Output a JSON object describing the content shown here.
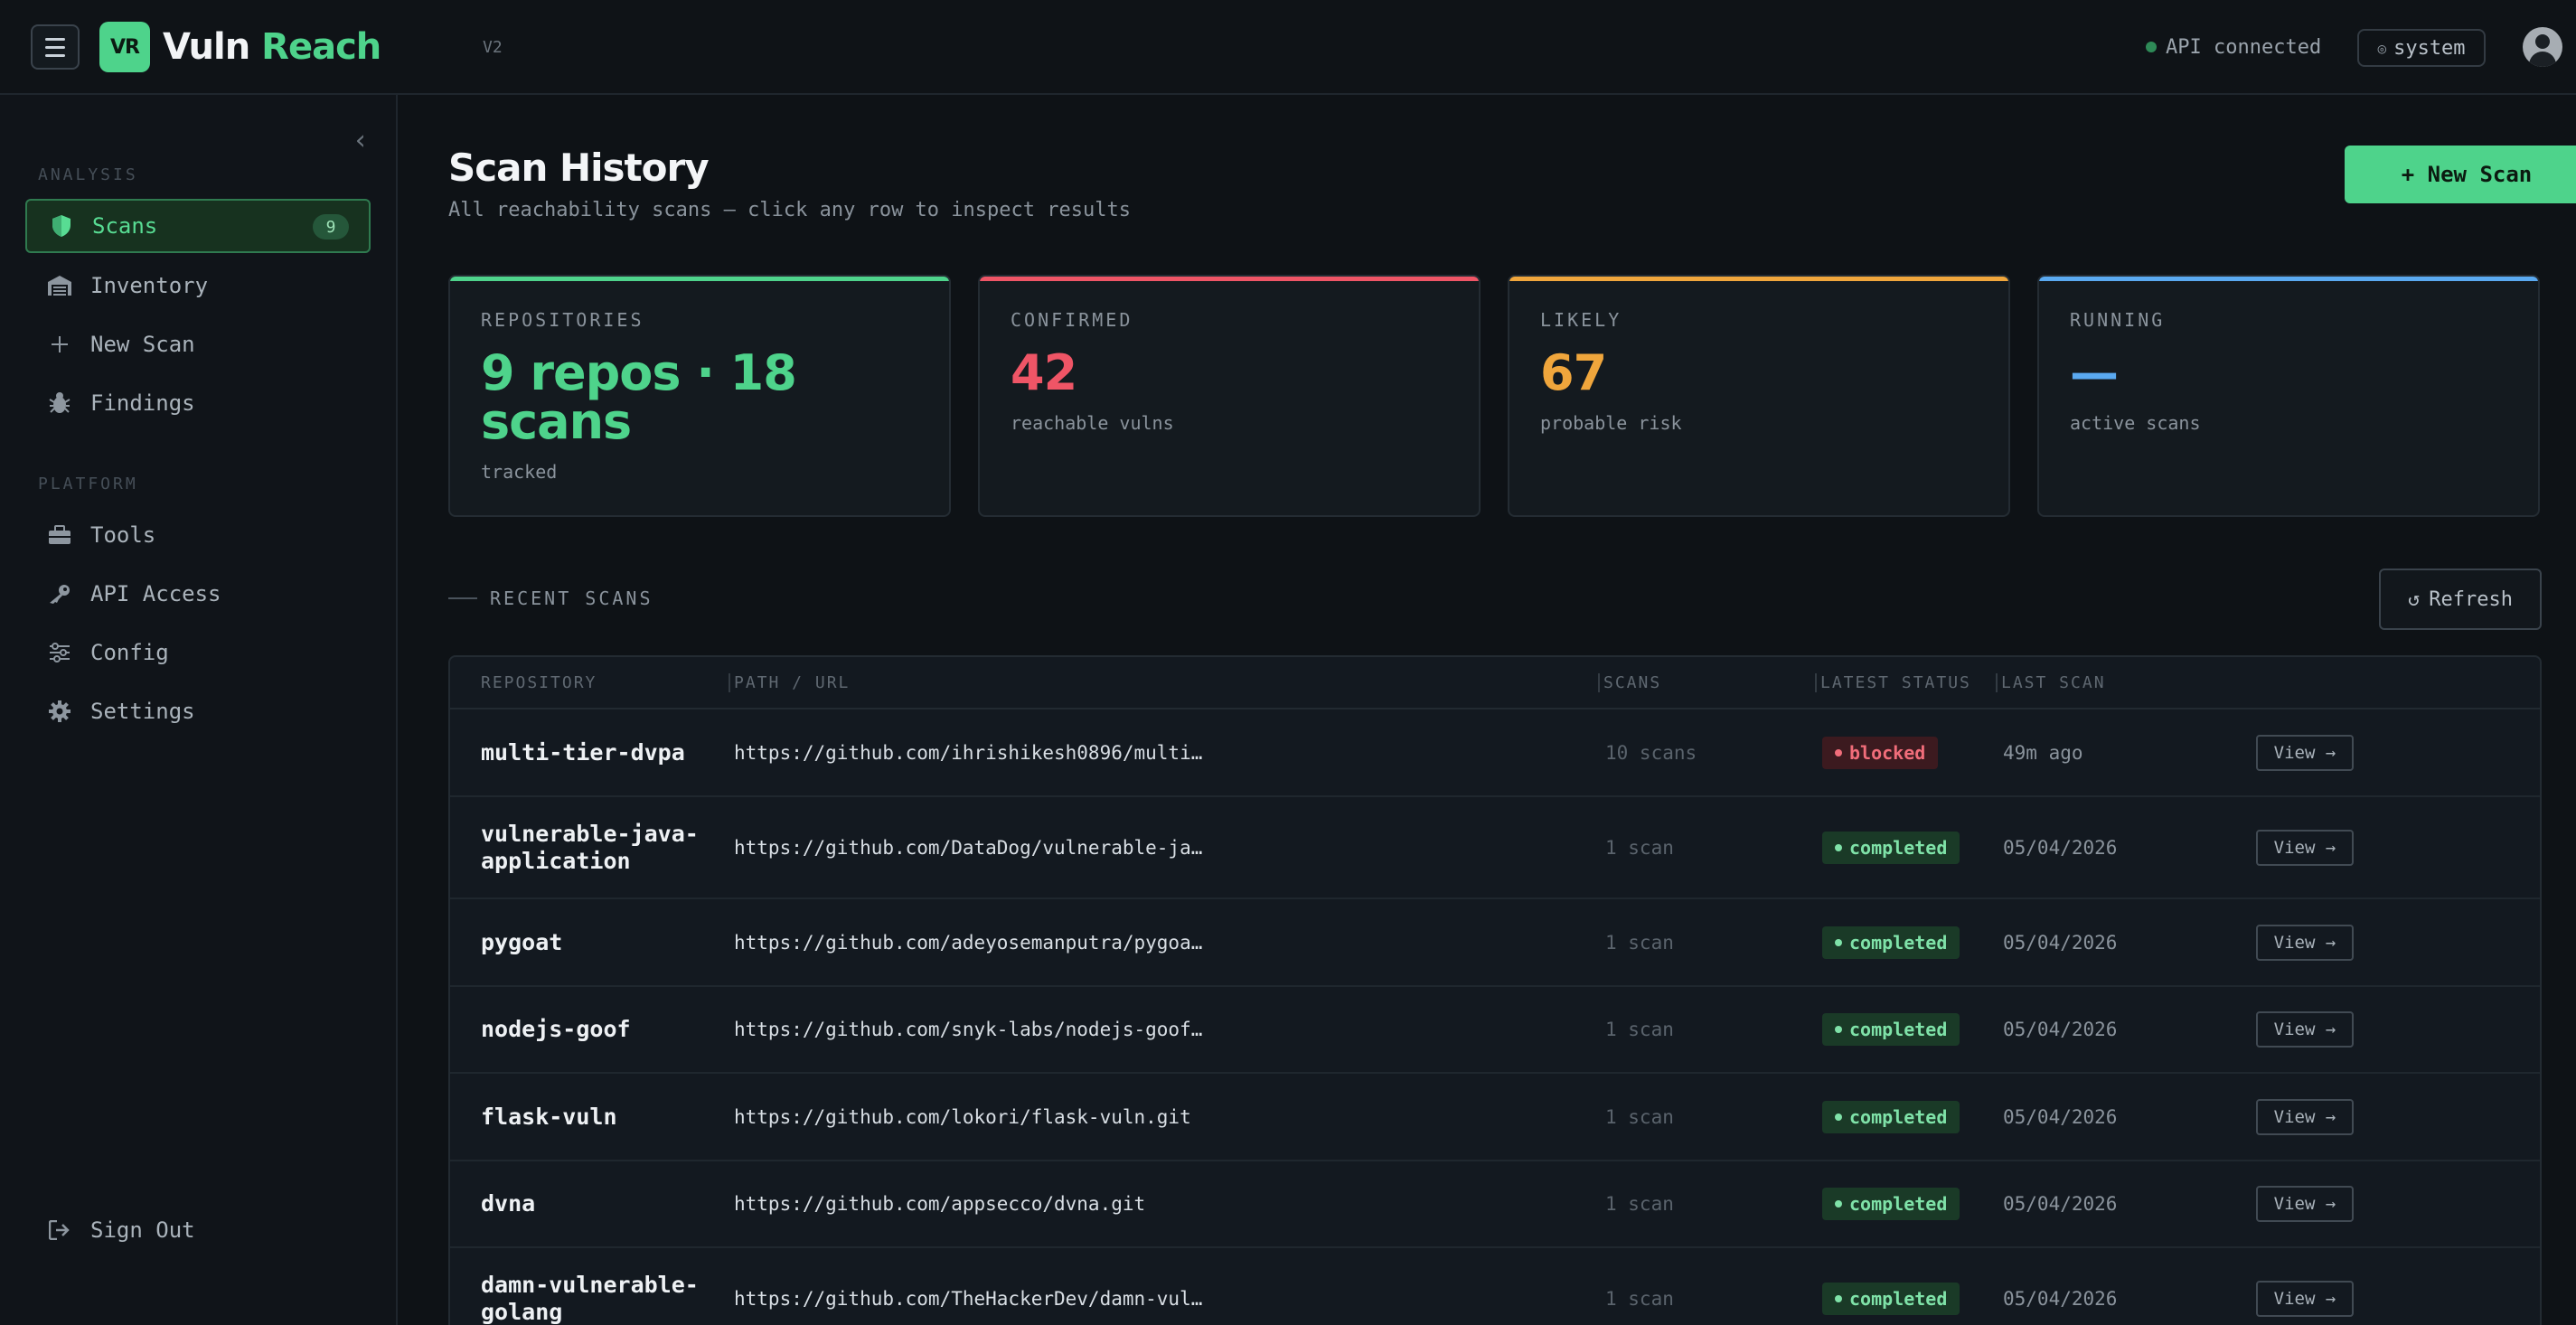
{
  "header": {
    "logo_mark": "VR",
    "app_name_part1": "Vuln",
    "app_name_part2": "Reach",
    "version": "V2",
    "api_status": "API connected",
    "theme_label": "system",
    "theme_icon": "◎"
  },
  "sidebar": {
    "section_analysis": "ANALYSIS",
    "section_platform": "PLATFORM",
    "items": [
      {
        "label": "Scans",
        "icon": "shield-icon",
        "badge": "9",
        "active": true
      },
      {
        "label": "Inventory",
        "icon": "warehouse-icon"
      },
      {
        "label": "New Scan",
        "icon": "plus-icon"
      },
      {
        "label": "Findings",
        "icon": "bug-icon"
      },
      {
        "label": "Tools",
        "icon": "toolbox-icon"
      },
      {
        "label": "API Access",
        "icon": "key-icon"
      },
      {
        "label": "Config",
        "icon": "sliders-icon"
      },
      {
        "label": "Settings",
        "icon": "gear-icon"
      }
    ],
    "sign_out": "Sign Out"
  },
  "page": {
    "title": "Scan History",
    "subtitle": "All reachability scans — click any row to inspect results",
    "new_scan_label": "+ New Scan",
    "recent_label": "RECENT SCANS",
    "refresh_label": "Refresh"
  },
  "stats": [
    {
      "label": "REPOSITORIES",
      "value": "9 repos · 18 scans",
      "note": "tracked",
      "color": "#4ed38b"
    },
    {
      "label": "CONFIRMED",
      "value": "42",
      "note": "reachable vulns",
      "color": "#ef5566"
    },
    {
      "label": "LIKELY",
      "value": "67",
      "note": "probable risk",
      "color": "#f0a63c"
    },
    {
      "label": "RUNNING",
      "value": "—",
      "note": "active scans",
      "color": "#5aa9f0"
    }
  ],
  "table": {
    "columns": [
      "REPOSITORY",
      "PATH / URL",
      "SCANS",
      "LATEST STATUS",
      "LAST SCAN"
    ],
    "view_label": "View →",
    "rows": [
      {
        "repo": "multi-tier-dvpa",
        "url": "https://github.com/ihrishikesh0896/multi…",
        "scans": "10 scans",
        "status": "blocked",
        "last": "49m ago"
      },
      {
        "repo": "vulnerable-java-application",
        "url": "https://github.com/DataDog/vulnerable-ja…",
        "scans": "1 scan",
        "status": "completed",
        "last": "05/04/2026"
      },
      {
        "repo": "pygoat",
        "url": "https://github.com/adeyosemanputra/pygoa…",
        "scans": "1 scan",
        "status": "completed",
        "last": "05/04/2026"
      },
      {
        "repo": "nodejs-goof",
        "url": "https://github.com/snyk-labs/nodejs-goof…",
        "scans": "1 scan",
        "status": "completed",
        "last": "05/04/2026"
      },
      {
        "repo": "flask-vuln",
        "url": "https://github.com/lokori/flask-vuln.git",
        "scans": "1 scan",
        "status": "completed",
        "last": "05/04/2026"
      },
      {
        "repo": "dvna",
        "url": "https://github.com/appsecco/dvna.git",
        "scans": "1 scan",
        "status": "completed",
        "last": "05/04/2026"
      },
      {
        "repo": "damn-vulnerable-golang",
        "url": "https://github.com/TheHackerDev/damn-vul…",
        "scans": "1 scan",
        "status": "completed",
        "last": "05/04/2026"
      }
    ]
  }
}
